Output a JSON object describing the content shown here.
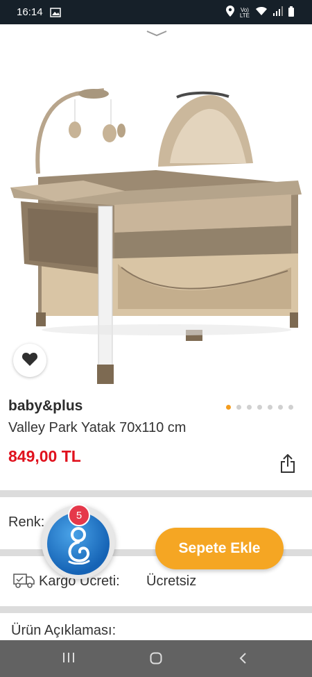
{
  "status_bar": {
    "time": "16:14",
    "icons": [
      "photo-icon",
      "location-icon",
      "volte-icon",
      "wifi-icon",
      "signal-icon",
      "battery-icon"
    ]
  },
  "product": {
    "brand": "baby&plus",
    "title": "Valley Park Yatak 70x110 cm",
    "price": "849,00 TL",
    "image_pagination": {
      "total": 7,
      "active_index": 0
    }
  },
  "options": {
    "color_label": "Renk:"
  },
  "cart": {
    "add_label": "Sepete Ekle",
    "badge_count": "5"
  },
  "shipping": {
    "label": "Kargo Ücreti:",
    "value": "Ücretsiz"
  },
  "description": {
    "label": "Ürün Açıklaması:"
  },
  "colors": {
    "accent": "#f5a623",
    "price": "#e0111d",
    "active_dot": "#f39c1f",
    "fab_blue": "#1563b5",
    "badge": "#e5384a",
    "status_bar": "#162029",
    "nav_bar": "#626262"
  }
}
